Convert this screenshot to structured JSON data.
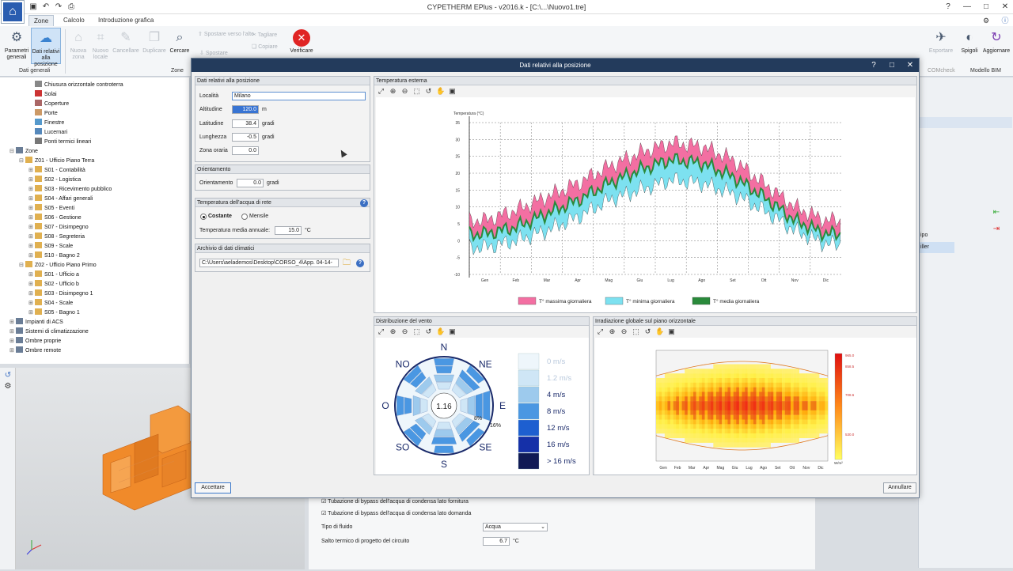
{
  "app": {
    "title": "CYPETHERM EPlus - v2016.k - [C:\\...\\Nuovo1.tre]",
    "logo": "logo-icon",
    "quick_access_icons": [
      "save-icon",
      "undo-icon",
      "redo-icon",
      "print-icon"
    ],
    "window_controls": {
      "help": "?",
      "minimize": "—",
      "maximize": "□",
      "close": "✕"
    }
  },
  "menu": {
    "tabs": [
      {
        "label": "Zone",
        "active": true
      },
      {
        "label": "Calcolo",
        "active": false
      },
      {
        "label": "Introduzione grafica",
        "active": false
      }
    ]
  },
  "ribbon": {
    "buttons": [
      {
        "label": "Parametri generali",
        "icon": "gear-icon",
        "enabled": true,
        "selected": false
      },
      {
        "label": "Dati relativi alla posizione",
        "icon": "cloud-sun-icon",
        "enabled": true,
        "selected": true
      },
      {
        "label": "Nuova zona",
        "icon": "house-icon",
        "enabled": false
      },
      {
        "label": "Nuovo locale",
        "icon": "room-icon",
        "enabled": false
      },
      {
        "label": "Cancellare",
        "icon": "eraser-icon",
        "enabled": false
      },
      {
        "label": "Duplicare",
        "icon": "duplicate-icon",
        "enabled": false
      },
      {
        "label": "Cercare",
        "icon": "binoculars-icon",
        "enabled": true
      },
      {
        "label": "Spostare verso l'alto",
        "icon": "arrow-up-icon",
        "enabled": false
      },
      {
        "label": "Spostare",
        "icon": "arrow-down-icon",
        "enabled": false
      },
      {
        "label": "Tagliare",
        "icon": "scissors-icon",
        "enabled": false
      },
      {
        "label": "Copiare",
        "icon": "copy-icon",
        "enabled": false
      },
      {
        "label": "Verificare",
        "icon": "close-circle-icon",
        "enabled": true
      }
    ],
    "groups": [
      "Dati generali",
      "Zone"
    ],
    "right_buttons": [
      {
        "label": "Esportare",
        "icon": "export-icon"
      },
      {
        "label": "Spigoli",
        "icon": "edges-icon"
      },
      {
        "label": "Aggiornare",
        "icon": "refresh-icon"
      }
    ],
    "right_groups": [
      "COMcheck",
      "Modello BIM"
    ]
  },
  "tree": {
    "items": [
      {
        "label": "Chiusura orizzontale controterra",
        "level": 3,
        "toggle": ""
      },
      {
        "label": "Solai",
        "level": 3,
        "toggle": ""
      },
      {
        "label": "Coperture",
        "level": 3,
        "toggle": ""
      },
      {
        "label": "Porte",
        "level": 3,
        "toggle": ""
      },
      {
        "label": "Finestre",
        "level": 3,
        "toggle": ""
      },
      {
        "label": "Lucernari",
        "level": 3,
        "toggle": ""
      },
      {
        "label": "Ponti termici lineari",
        "level": 3,
        "toggle": ""
      },
      {
        "label": "Zone",
        "level": 1,
        "toggle": "⊟"
      },
      {
        "label": "Z01 - Ufficio Piano Terra",
        "level": 2,
        "toggle": "⊟"
      },
      {
        "label": "S01 - Contabilità",
        "level": 3,
        "toggle": "⊞"
      },
      {
        "label": "S02 - Logistica",
        "level": 3,
        "toggle": "⊞"
      },
      {
        "label": "S03 - Ricevimento pubblico",
        "level": 3,
        "toggle": "⊞"
      },
      {
        "label": "S04 - Affari generali",
        "level": 3,
        "toggle": "⊞"
      },
      {
        "label": "S05 - Eventi",
        "level": 3,
        "toggle": "⊞"
      },
      {
        "label": "S06 - Gestione",
        "level": 3,
        "toggle": "⊞"
      },
      {
        "label": "S07 - Disimpegno",
        "level": 3,
        "toggle": "⊞"
      },
      {
        "label": "S08 - Segreteria",
        "level": 3,
        "toggle": "⊞"
      },
      {
        "label": "S09 - Scale",
        "level": 3,
        "toggle": "⊞"
      },
      {
        "label": "S10 - Bagno 2",
        "level": 3,
        "toggle": "⊞"
      },
      {
        "label": "Z02 - Ufficio Piano Primo",
        "level": 2,
        "toggle": "⊟"
      },
      {
        "label": "S01 - Ufficio a",
        "level": 3,
        "toggle": "⊞"
      },
      {
        "label": "S02 - Ufficio b",
        "level": 3,
        "toggle": "⊞"
      },
      {
        "label": "S03 - Disimpegno 1",
        "level": 3,
        "toggle": "⊞"
      },
      {
        "label": "S04 - Scale",
        "level": 3,
        "toggle": "⊞"
      },
      {
        "label": "S05 - Bagno 1",
        "level": 3,
        "toggle": "⊞"
      },
      {
        "label": "Impianti di ACS",
        "level": 1,
        "toggle": "⊞"
      },
      {
        "label": "Sistemi di climatizzazione",
        "level": 1,
        "toggle": "⊞"
      },
      {
        "label": "Ombre proprie",
        "level": 1,
        "toggle": "⊞"
      },
      {
        "label": "Ombre remote",
        "level": 1,
        "toggle": "⊞"
      }
    ]
  },
  "props_panel": {
    "checkbox1": "Tubazione di bypass dell'acqua di condensa lato fornitura",
    "checkbox2": "Tubazione di bypass dell'acqua di condensa lato domanda",
    "fluid_label": "Tipo di fluido",
    "fluid_value": "Acqua",
    "dt_label": "Salto termico di progetto del circuito",
    "dt_value": "6.7",
    "dt_unit": "°C"
  },
  "right_panel": {
    "row1": "ipo",
    "row2": "iller"
  },
  "dialog": {
    "title": "Dati relativi alla posizione",
    "position": {
      "header": "Dati relativi alla posizione",
      "locality_label": "Località",
      "locality_value": "Milano",
      "altitude_label": "Altitudine",
      "altitude_value": "120.0",
      "altitude_unit": "m",
      "latitude_label": "Latitudine",
      "latitude_value": "38.4",
      "latitude_unit": "gradi",
      "longitude_label": "Lunghezza",
      "longitude_value": "-0.5",
      "longitude_unit": "gradi",
      "timezone_label": "Zona oraria",
      "timezone_value": "0.0"
    },
    "orientation": {
      "header": "Orientamento",
      "label": "Orientamento",
      "value": "0.0",
      "unit": "gradi"
    },
    "water": {
      "header": "Temperatura dell'acqua di rete",
      "opt1": "Costante",
      "opt2": "Mensile",
      "selected": "Costante",
      "avg_label": "Temperatura media annuale:",
      "avg_value": "15.0",
      "avg_unit": "°C"
    },
    "climate": {
      "header": "Archivio di dati climatici",
      "path": "C:\\Users\\aelademos\\Desktop\\CORSO_4\\App. 04-14-"
    },
    "accept": "Accettare",
    "cancel": "Annullare"
  },
  "chart_toolbar_icons": [
    "zoom-extents-icon",
    "zoom-in-icon",
    "zoom-out-icon",
    "zoom-window-icon",
    "zoom-previous-icon",
    "pan-icon",
    "fit-icon"
  ],
  "chart_data": [
    {
      "panel_title": "Temperatura esterna",
      "type": "area",
      "ylabel": "Temperatura (°C)",
      "ylim": [
        -10,
        35
      ],
      "yticks": [
        -10,
        -5,
        0,
        5,
        10,
        15,
        20,
        25,
        30,
        35
      ],
      "categories": [
        "Gen",
        "Feb",
        "Mar",
        "Apr",
        "Mag",
        "Giu",
        "Lug",
        "Ago",
        "Set",
        "Ott",
        "Nov",
        "Dic"
      ],
      "grid": true,
      "legend_position": "bottom",
      "series": [
        {
          "name": "T° massima giornaliera",
          "color": "#f36fa2",
          "values": [
            6,
            9,
            13,
            17,
            22,
            26,
            29,
            28,
            24,
            17,
            10,
            6
          ]
        },
        {
          "name": "T° minima giornaliera",
          "color": "#7de1f0",
          "values": [
            -2,
            0,
            3,
            7,
            12,
            15,
            18,
            17,
            14,
            9,
            3,
            -1
          ]
        },
        {
          "name": "T° media giornaliera",
          "color": "#2a8a3b",
          "values": [
            2,
            4,
            8,
            12,
            17,
            21,
            24,
            23,
            19,
            13,
            6,
            2
          ]
        }
      ]
    },
    {
      "panel_title": "Distribuzione del vento",
      "type": "wind-rose",
      "directions": [
        "N",
        "NE",
        "E",
        "SE",
        "S",
        "SO",
        "O",
        "NO"
      ],
      "center_value": "1.16",
      "annotations": [
        "8%",
        "16%"
      ],
      "speed_classes": [
        {
          "label": "0 m/s",
          "color": "#eef6fb"
        },
        {
          "label": "1.2 m/s",
          "color": "#cfe6f6"
        },
        {
          "label": "4 m/s",
          "color": "#9dcaed"
        },
        {
          "label": "8 m/s",
          "color": "#4a97e2"
        },
        {
          "label": "12 m/s",
          "color": "#1d5fd0"
        },
        {
          "label": "16 m/s",
          "color": "#1530a8"
        },
        {
          "label": "> 16 m/s",
          "color": "#101a55"
        }
      ],
      "frequencies": [
        2,
        3,
        4,
        3,
        3,
        2,
        2,
        2
      ]
    },
    {
      "panel_title": "Irradiazione globale sul piano orizzontale",
      "type": "heatmap",
      "months": [
        "Gen",
        "Feb",
        "Mar",
        "Apr",
        "Mag",
        "Giu",
        "Lug",
        "Ago",
        "Set",
        "Ott",
        "Nov",
        "Dic"
      ],
      "scale_max": 1070,
      "scale_unit": "W/m²",
      "colorbar_ticks": [
        "965.0",
        "858.5",
        "708.6",
        "530.0"
      ]
    }
  ]
}
